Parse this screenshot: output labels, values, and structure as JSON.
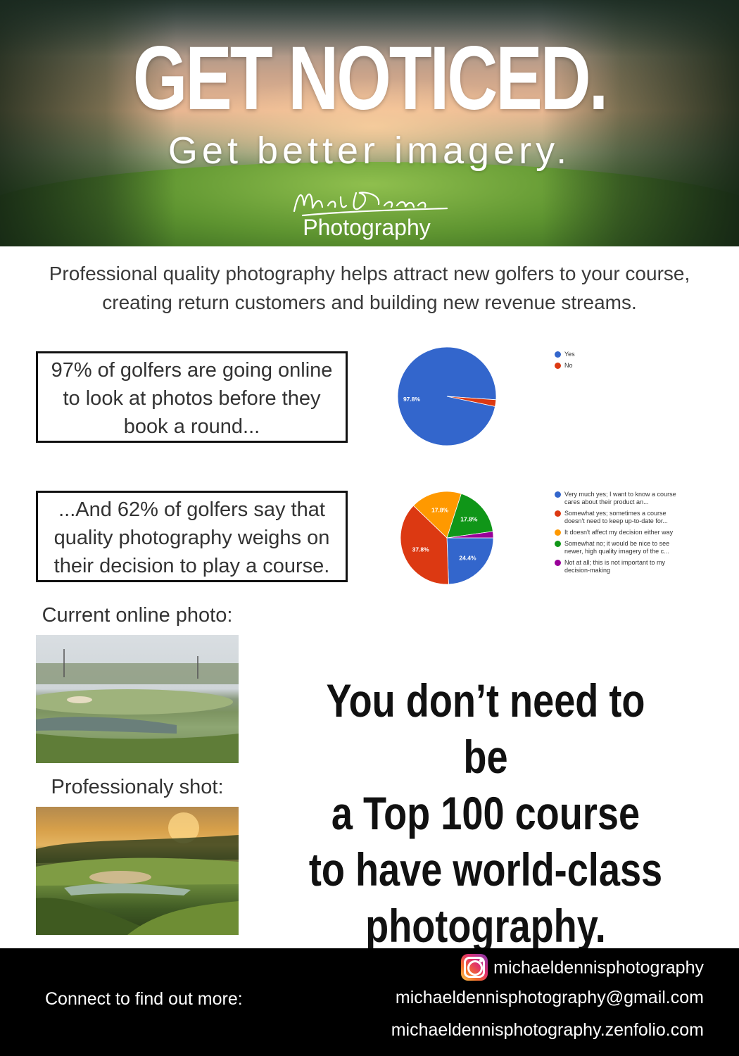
{
  "hero": {
    "headline": "GET NOTICED.",
    "subhead": "Get better imagery.",
    "signature": "Michael Dennis",
    "photography_label": "Photography"
  },
  "intro": {
    "line1": "Professional quality photography helps attract new golfers to your course,",
    "line2": "creating return customers and building new revenue streams."
  },
  "stats": {
    "box1": [
      "97% of golfers are going online",
      "to look at photos before they",
      "book a round..."
    ],
    "box2": [
      "...And 62% of golfers say that",
      "quality photography weighs on",
      "their decision to play a course."
    ]
  },
  "chart_data": [
    {
      "type": "pie",
      "categories": [
        "Yes",
        "No"
      ],
      "values": [
        97.8,
        2.2
      ],
      "colors": [
        "#3366cc",
        "#dc3912"
      ],
      "data_labels": [
        "97.8%",
        ""
      ],
      "legend_position": "top-right"
    },
    {
      "type": "pie",
      "categories": [
        "Very much yes; I want to know a course cares about their product an...",
        "Somewhat yes; sometimes a course doesn't need to keep up-to-date for...",
        "It doesn't affect my decision either way",
        "Somewhat no; it would be nice to see newer, high quality imagery of the c...",
        "Not at all; this is not important to my decision-making"
      ],
      "values": [
        24.4,
        37.8,
        17.8,
        17.8,
        2.2
      ],
      "colors": [
        "#3366cc",
        "#dc3912",
        "#ff9900",
        "#109618",
        "#990099"
      ],
      "data_labels": [
        "24.4%",
        "37.8%",
        "17.8%",
        "17.8%",
        ""
      ],
      "legend_position": "right"
    }
  ],
  "photos": {
    "current_caption": "Current online photo:",
    "pro_caption": "Professionaly shot:"
  },
  "tagline": [
    "You don’t need to be",
    "a Top 100 course",
    "to have world-class",
    "photography."
  ],
  "footer": {
    "connect": "Connect to find out more:",
    "instagram": "michaeldennisphotography",
    "email": "michaeldennisphotography@gmail.com",
    "website": "michaeldennisphotography.zenfolio.com"
  }
}
